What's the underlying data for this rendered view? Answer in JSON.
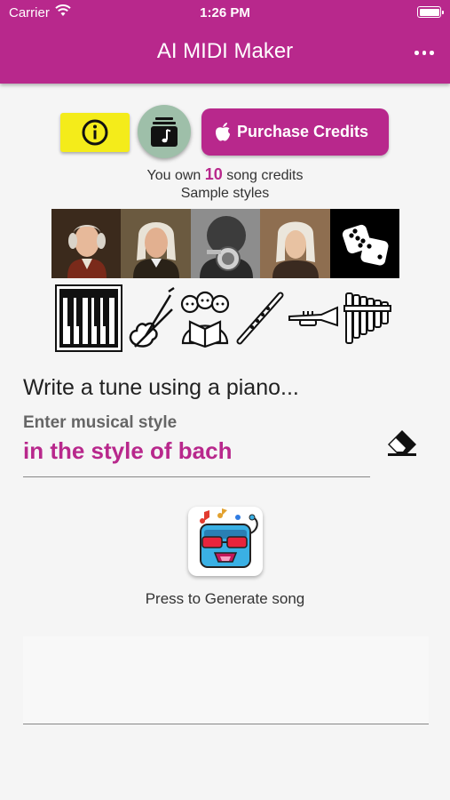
{
  "status_bar": {
    "carrier": "Carrier",
    "time": "1:26 PM"
  },
  "app_bar": {
    "title": "AI MIDI Maker",
    "menu_icon": "more-horiz-icon"
  },
  "toolbar": {
    "info_icon": "info-icon",
    "song_icon": "music-note-icon",
    "purchase_label": "Purchase Credits",
    "purchase_icon": "apple-icon"
  },
  "credits": {
    "prefix": "You own",
    "count": "10",
    "suffix": "song credits"
  },
  "sample_styles": {
    "label": "Sample styles",
    "items": [
      "mozart",
      "bach",
      "louis-armstrong",
      "vivaldi",
      "random-dice"
    ]
  },
  "instruments": {
    "items": [
      "piano",
      "violin",
      "choir",
      "flute",
      "trumpet",
      "pan-flute"
    ],
    "selected": "piano"
  },
  "prompt": "Write a tune using a piano...",
  "style_field": {
    "label": "Enter musical style",
    "value": "in the style of bach",
    "clear_icon": "eraser-icon"
  },
  "generate": {
    "label": "Press to Generate song",
    "icon": "robot-music-icon"
  },
  "colors": {
    "brand": "#b8288c",
    "info_button": "#f4ec1a",
    "song_button": "#9ebfa9"
  }
}
